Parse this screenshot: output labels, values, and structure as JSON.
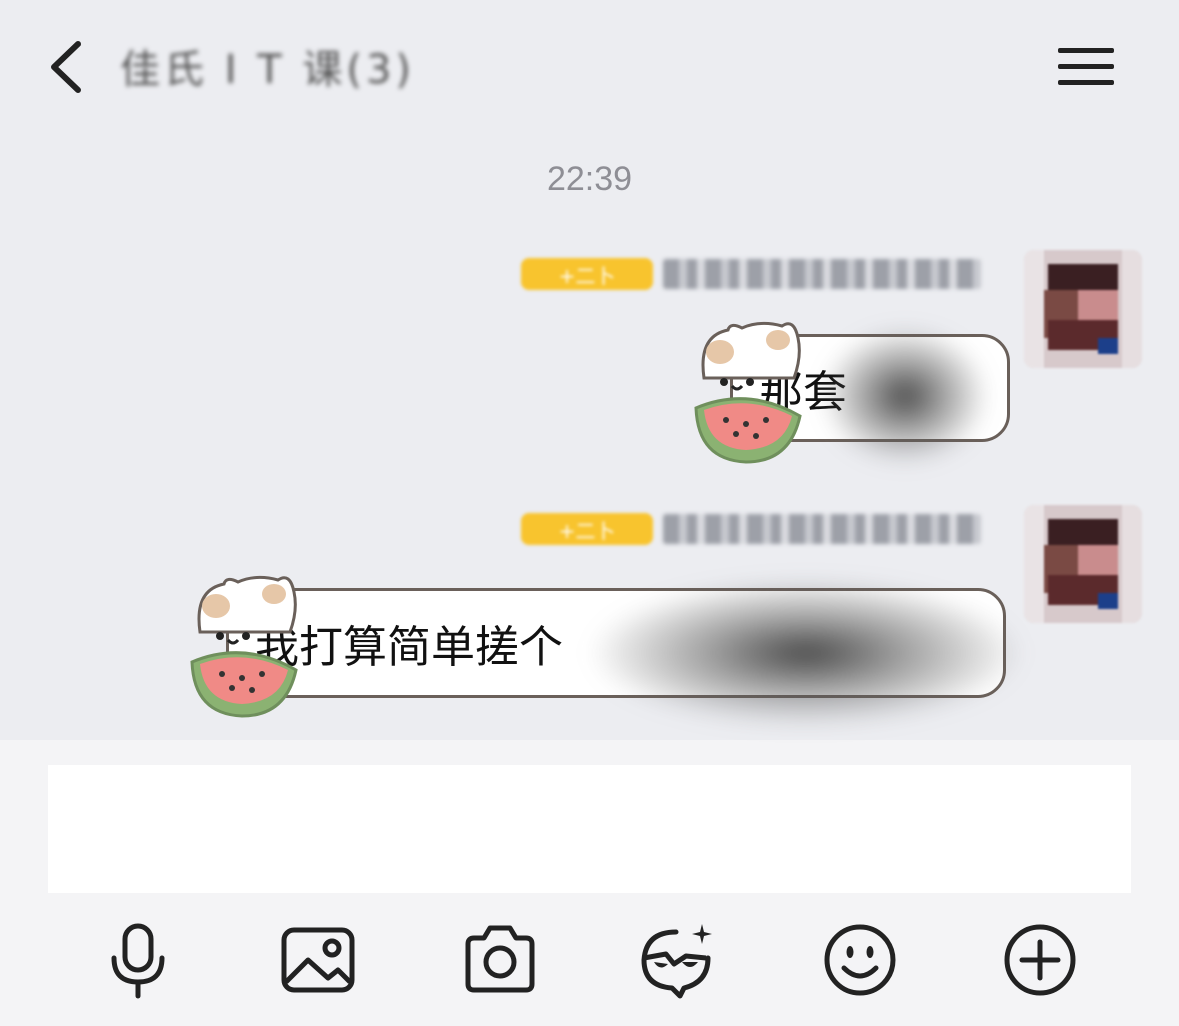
{
  "header": {
    "title": "佳氏 I T 课(3)",
    "back_icon": "chevron-left-icon",
    "menu_icon": "hamburger-menu-icon"
  },
  "timestamp": "22:39",
  "messages": [
    {
      "badge": "+二卜",
      "sender": "",
      "text": "那套",
      "sticker": "watermelon-cat-sticker"
    },
    {
      "badge": "+二卜",
      "sender": "",
      "text": "我打算简单搓个",
      "sticker": "watermelon-cat-sticker"
    }
  ],
  "composer": {
    "input_value": "",
    "input_placeholder": ""
  },
  "toolbar": {
    "items": [
      "microphone-icon",
      "image-icon",
      "camera-icon",
      "sticker-icon",
      "emoji-icon",
      "plus-circle-icon"
    ]
  },
  "colors": {
    "background": "#ECEDF1",
    "composer_bg": "#F4F4F6",
    "badge": "#F8C42E",
    "bubble_border": "#6A605A",
    "icon_dark": "#222222"
  }
}
